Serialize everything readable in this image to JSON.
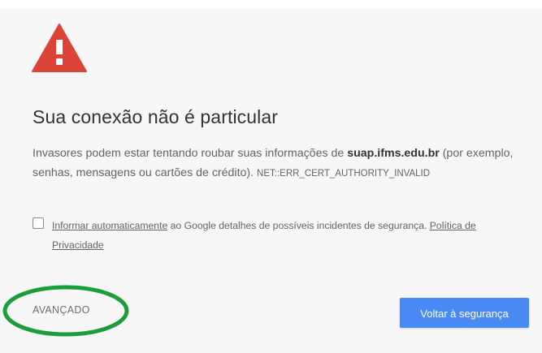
{
  "icons": {
    "warning": "warning-triangle-icon"
  },
  "colors": {
    "warning_red": "#db4437",
    "primary_button": "#4a8af4",
    "annotation_green": "#1b9e3a"
  },
  "interstitial": {
    "title": "Sua conexão não é particular",
    "explanation_before": "Invasores podem estar tentando roubar suas informações de ",
    "domain": "suap.ifms.edu.br",
    "explanation_after": " (por exemplo, senhas, mensagens ou cartões de crédito). ",
    "error_code": "NET::ERR_CERT_AUTHORITY_INVALID",
    "report": {
      "checked": false,
      "link_text": "Informar automaticamente",
      "text_middle": " ao Google detalhes de possíveis incidentes de segurança. ",
      "privacy_link": "Política de Privacidade"
    },
    "advanced_label": "AVANÇADO",
    "primary_button_label": "Voltar à segurança"
  }
}
